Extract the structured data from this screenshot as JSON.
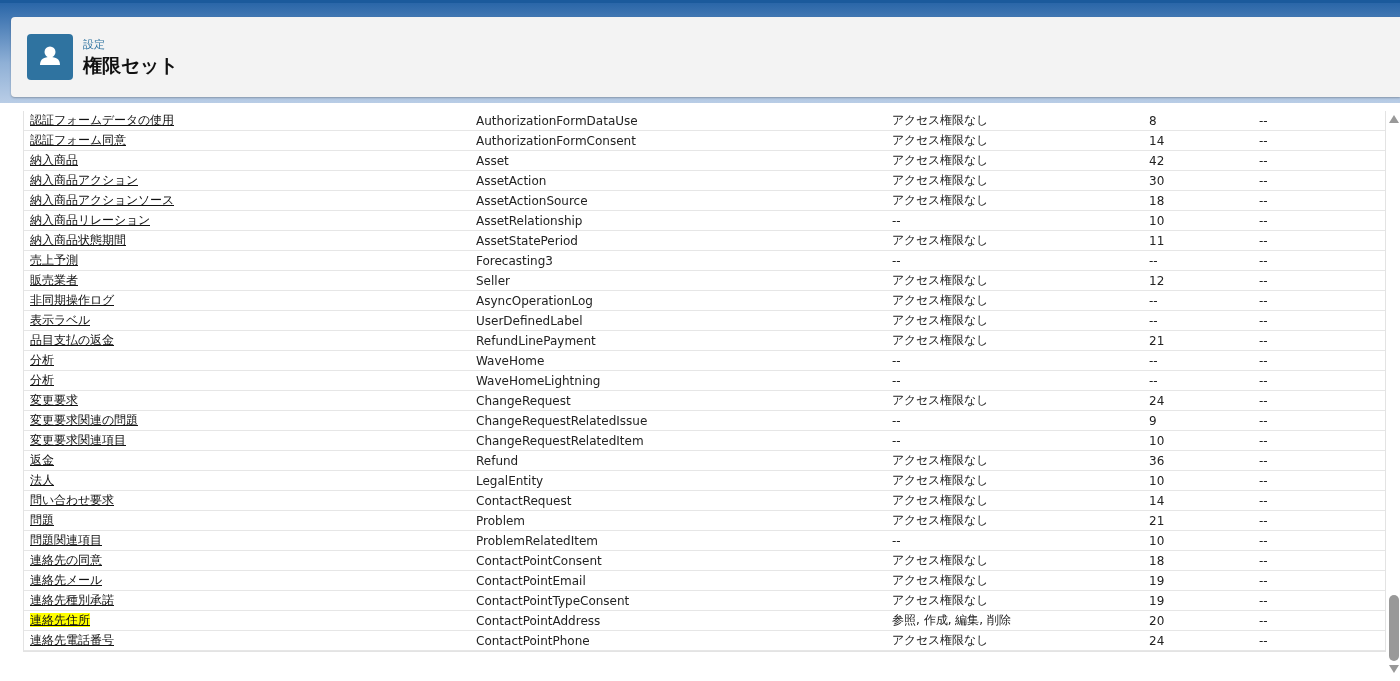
{
  "header": {
    "breadcrumb": "設定",
    "title": "権限セット"
  },
  "table": {
    "rows": [
      {
        "cells": [
          "認証フォームデータの使用",
          "AuthorizationFormDataUse",
          "アクセス権限なし",
          "8",
          "--"
        ],
        "highlighted": false
      },
      {
        "cells": [
          "認証フォーム同意",
          "AuthorizationFormConsent",
          "アクセス権限なし",
          "14",
          "--"
        ],
        "highlighted": false
      },
      {
        "cells": [
          "納入商品",
          "Asset",
          "アクセス権限なし",
          "42",
          "--"
        ],
        "highlighted": false
      },
      {
        "cells": [
          "納入商品アクション",
          "AssetAction",
          "アクセス権限なし",
          "30",
          "--"
        ],
        "highlighted": false
      },
      {
        "cells": [
          "納入商品アクションソース",
          "AssetActionSource",
          "アクセス権限なし",
          "18",
          "--"
        ],
        "highlighted": false
      },
      {
        "cells": [
          "納入商品リレーション",
          "AssetRelationship",
          "--",
          "10",
          "--"
        ],
        "highlighted": false
      },
      {
        "cells": [
          "納入商品状態期間",
          "AssetStatePeriod",
          "アクセス権限なし",
          "11",
          "--"
        ],
        "highlighted": false
      },
      {
        "cells": [
          "売上予測",
          "Forecasting3",
          "--",
          "--",
          "--"
        ],
        "highlighted": false
      },
      {
        "cells": [
          "販売業者",
          "Seller",
          "アクセス権限なし",
          "12",
          "--"
        ],
        "highlighted": false
      },
      {
        "cells": [
          "非同期操作ログ",
          "AsyncOperationLog",
          "アクセス権限なし",
          "--",
          "--"
        ],
        "highlighted": false
      },
      {
        "cells": [
          "表示ラベル",
          "UserDefinedLabel",
          "アクセス権限なし",
          "--",
          "--"
        ],
        "highlighted": false
      },
      {
        "cells": [
          "品目支払の返金",
          "RefundLinePayment",
          "アクセス権限なし",
          "21",
          "--"
        ],
        "highlighted": false
      },
      {
        "cells": [
          "分析",
          "WaveHome",
          "--",
          "--",
          "--"
        ],
        "highlighted": false
      },
      {
        "cells": [
          "分析",
          "WaveHomeLightning",
          "--",
          "--",
          "--"
        ],
        "highlighted": false
      },
      {
        "cells": [
          "変更要求",
          "ChangeRequest",
          "アクセス権限なし",
          "24",
          "--"
        ],
        "highlighted": false
      },
      {
        "cells": [
          "変更要求関連の問題",
          "ChangeRequestRelatedIssue",
          "--",
          "9",
          "--"
        ],
        "highlighted": false
      },
      {
        "cells": [
          "変更要求関連項目",
          "ChangeRequestRelatedItem",
          "--",
          "10",
          "--"
        ],
        "highlighted": false
      },
      {
        "cells": [
          "返金",
          "Refund",
          "アクセス権限なし",
          "36",
          "--"
        ],
        "highlighted": false
      },
      {
        "cells": [
          "法人",
          "LegalEntity",
          "アクセス権限なし",
          "10",
          "--"
        ],
        "highlighted": false
      },
      {
        "cells": [
          "問い合わせ要求",
          "ContactRequest",
          "アクセス権限なし",
          "14",
          "--"
        ],
        "highlighted": false
      },
      {
        "cells": [
          "問題",
          "Problem",
          "アクセス権限なし",
          "21",
          "--"
        ],
        "highlighted": false
      },
      {
        "cells": [
          "問題関連項目",
          "ProblemRelatedItem",
          "--",
          "10",
          "--"
        ],
        "highlighted": false
      },
      {
        "cells": [
          "連絡先の同意",
          "ContactPointConsent",
          "アクセス権限なし",
          "18",
          "--"
        ],
        "highlighted": false
      },
      {
        "cells": [
          "連絡先メール",
          "ContactPointEmail",
          "アクセス権限なし",
          "19",
          "--"
        ],
        "highlighted": false
      },
      {
        "cells": [
          "連絡先種別承諾",
          "ContactPointTypeConsent",
          "アクセス権限なし",
          "19",
          "--"
        ],
        "highlighted": false
      },
      {
        "cells": [
          "連絡先住所",
          "ContactPointAddress",
          "参照, 作成, 編集, 削除",
          "20",
          "--"
        ],
        "highlighted": true
      },
      {
        "cells": [
          "連絡先電話番号",
          "ContactPointPhone",
          "アクセス権限なし",
          "24",
          "--"
        ],
        "highlighted": false
      }
    ]
  }
}
